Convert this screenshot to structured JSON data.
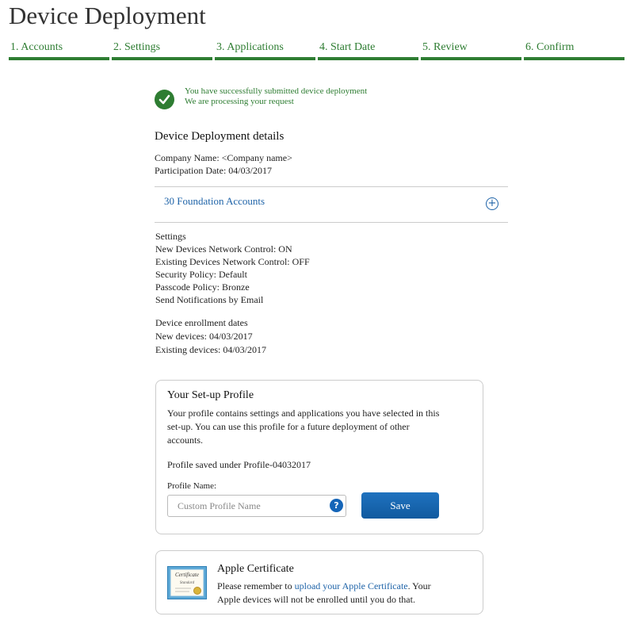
{
  "page": {
    "title": "Device Deployment"
  },
  "steps": [
    {
      "label": "1. Accounts"
    },
    {
      "label": "2. Settings"
    },
    {
      "label": "3. Applications"
    },
    {
      "label": "4. Start Date"
    },
    {
      "label": "5. Review"
    },
    {
      "label": "6. Confirm"
    }
  ],
  "success": {
    "line1": "You have successfully submitted device deployment",
    "line2": "We are processing your request"
  },
  "details": {
    "title": "Device Deployment details",
    "company": "Company Name: <Company name>",
    "participation": "Participation Date:  04/03/2017"
  },
  "accordion": {
    "label": "30 Foundation Accounts",
    "toggle": "+"
  },
  "settings": {
    "heading": "Settings",
    "items": [
      "New Devices Network Control: ON",
      "Existing Devices Network Control: OFF",
      "Security Policy: Default",
      "Passcode Policy: Bronze",
      "Send Notifications by Email"
    ]
  },
  "enrollment": {
    "heading": "Device enrollment dates",
    "new": "New devices: 04/03/2017",
    "existing": "Existing devices: 04/03/2017"
  },
  "profile": {
    "title": "Your Set-up Profile",
    "text_line1": "Your profile contains settings and applications you have selected in this",
    "text_line2": "set-up. You can use this profile for a future deployment of other",
    "text_line3": "accounts.",
    "saved": "Profile saved under Profile-04032017",
    "name_label": "Profile Name:",
    "placeholder": "Custom Profile Name",
    "help": "?",
    "save": "Save"
  },
  "certificate": {
    "title": "Apple Certificate",
    "text_before": "Please remember to ",
    "link": "upload your Apple Certificate",
    "text_after": ". Your",
    "text_line2": "Apple devices will not be enrolled until you do that.",
    "image_title": "Certificate",
    "image_sub": "Standard"
  },
  "colors": {
    "green": "#2e7d32",
    "link": "#1e63a8",
    "button": "#1565b8"
  }
}
